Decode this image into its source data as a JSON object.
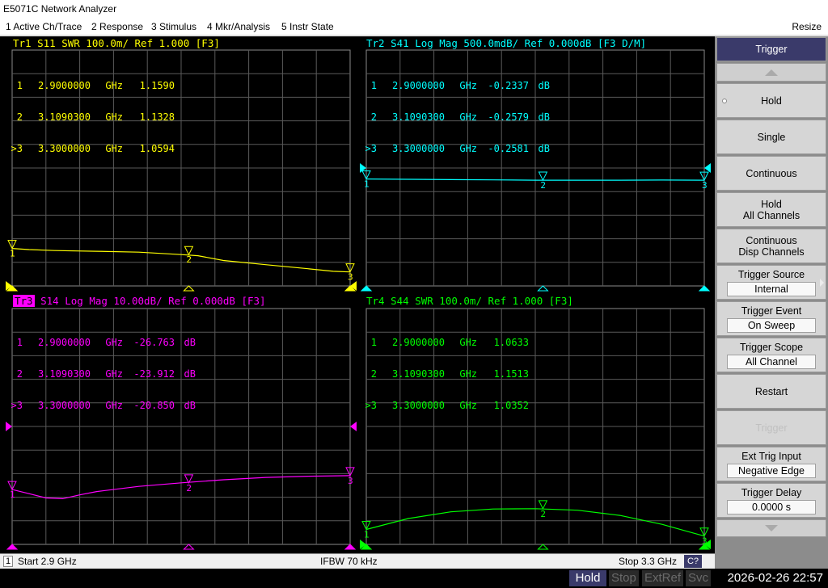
{
  "window": {
    "title": "E5071C Network Analyzer"
  },
  "menu": {
    "items": [
      "1 Active Ch/Trace",
      "2 Response",
      "3 Stimulus",
      "4 Mkr/Analysis",
      "5 Instr State"
    ],
    "resize": "Resize"
  },
  "traces": [
    {
      "id": "tr1",
      "color": "#ffff00",
      "header": "Tr1 S11 SWR 100.0m/ Ref 1.000 [F3]",
      "markers": [
        {
          "idx": "1",
          "freq": "2.9000000",
          "unit": "GHz",
          "value": "1.1590",
          "vunit": ""
        },
        {
          "idx": "2",
          "freq": "3.1090300",
          "unit": "GHz",
          "value": "1.1328",
          "vunit": ""
        },
        {
          "idx": ">3",
          "freq": "3.3000000",
          "unit": "GHz",
          "value": "1.0594",
          "vunit": ""
        }
      ],
      "scale": {
        "ref": 1.0,
        "per_div": 0.1,
        "ref_div": 0
      },
      "points": [
        [
          2.9,
          1.159
        ],
        [
          2.92,
          1.154
        ],
        [
          2.95,
          1.15
        ],
        [
          3.0,
          1.147
        ],
        [
          3.05,
          1.143
        ],
        [
          3.1,
          1.1328
        ],
        [
          3.12,
          1.128
        ],
        [
          3.15,
          1.108
        ],
        [
          3.2,
          1.09
        ],
        [
          3.25,
          1.073
        ],
        [
          3.28,
          1.062
        ],
        [
          3.3,
          1.0594
        ]
      ],
      "marker_labels": [
        "1",
        "2",
        "3"
      ]
    },
    {
      "id": "tr2",
      "color": "#00ffff",
      "header": "Tr2 S41 Log Mag 500.0mdB/ Ref 0.000dB [F3 D/M]",
      "markers": [
        {
          "idx": "1",
          "freq": "2.9000000",
          "unit": "GHz",
          "value": "-0.2337",
          "vunit": "dB"
        },
        {
          "idx": "2",
          "freq": "3.1090300",
          "unit": "GHz",
          "value": "-0.2579",
          "vunit": "dB"
        },
        {
          "idx": ">3",
          "freq": "3.3000000",
          "unit": "GHz",
          "value": "-0.2581",
          "vunit": "dB"
        }
      ],
      "scale": {
        "ref": 0.0,
        "per_div": 0.5,
        "ref_div": 5
      },
      "points": [
        [
          2.9,
          -0.2337
        ],
        [
          2.95,
          -0.24
        ],
        [
          3.0,
          -0.247
        ],
        [
          3.05,
          -0.252
        ],
        [
          3.1,
          -0.2579
        ],
        [
          3.15,
          -0.258
        ],
        [
          3.2,
          -0.258
        ],
        [
          3.25,
          -0.255
        ],
        [
          3.3,
          -0.2581
        ]
      ],
      "marker_labels": [
        "1",
        "2",
        "3",
        "2"
      ]
    },
    {
      "id": "tr3",
      "color": "#ff00ff",
      "header": "S14 Log Mag 10.00dB/ Ref 0.000dB [F3]",
      "header_box": "Tr3",
      "markers": [
        {
          "idx": "1",
          "freq": "2.9000000",
          "unit": "GHz",
          "value": "-26.763",
          "vunit": "dB"
        },
        {
          "idx": "2",
          "freq": "3.1090300",
          "unit": "GHz",
          "value": "-23.912",
          "vunit": "dB"
        },
        {
          "idx": ">3",
          "freq": "3.3000000",
          "unit": "GHz",
          "value": "-20.850",
          "vunit": "dB"
        }
      ],
      "scale": {
        "ref": 0.0,
        "per_div": 10.0,
        "ref_div": 5
      },
      "points": [
        [
          2.9,
          -26.763
        ],
        [
          2.92,
          -28.5
        ],
        [
          2.94,
          -30.3
        ],
        [
          2.96,
          -30.6
        ],
        [
          2.98,
          -29.0
        ],
        [
          3.0,
          -27.6
        ],
        [
          3.05,
          -25.4
        ],
        [
          3.1,
          -23.912
        ],
        [
          3.15,
          -22.6
        ],
        [
          3.2,
          -21.6
        ],
        [
          3.25,
          -21.1
        ],
        [
          3.3,
          -20.85
        ]
      ],
      "marker_labels": [
        "1",
        "2",
        "3"
      ]
    },
    {
      "id": "tr4",
      "color": "#00ff00",
      "header": "Tr4 S44 SWR 100.0m/ Ref 1.000 [F3]",
      "markers": [
        {
          "idx": "1",
          "freq": "2.9000000",
          "unit": "GHz",
          "value": "1.0633",
          "vunit": ""
        },
        {
          "idx": "2",
          "freq": "3.1090300",
          "unit": "GHz",
          "value": "1.1513",
          "vunit": ""
        },
        {
          "idx": ">3",
          "freq": "3.3000000",
          "unit": "GHz",
          "value": "1.0352",
          "vunit": ""
        }
      ],
      "scale": {
        "ref": 1.0,
        "per_div": 0.1,
        "ref_div": 0
      },
      "points": [
        [
          2.9,
          1.0633
        ],
        [
          2.95,
          1.11
        ],
        [
          3.0,
          1.138
        ],
        [
          3.05,
          1.15
        ],
        [
          3.1,
          1.1513
        ],
        [
          3.15,
          1.145
        ],
        [
          3.2,
          1.123
        ],
        [
          3.25,
          1.085
        ],
        [
          3.28,
          1.055
        ],
        [
          3.3,
          1.0352
        ]
      ],
      "marker_labels": [
        "1",
        "2",
        "3",
        "4"
      ]
    }
  ],
  "stimulus": {
    "start_hz": 2.9,
    "stop_hz": 3.3
  },
  "status": {
    "channel": "1",
    "start": "Start 2.9 GHz",
    "ifbw": "IFBW 70 kHz",
    "stop": "Stop 3.3 GHz",
    "cal": "C?"
  },
  "bottom": {
    "hold": "Hold",
    "stop": "Stop",
    "extref": "ExtRef",
    "svc": "Svc",
    "datetime": "2026-02-26 22:57"
  },
  "softkeys": {
    "title": "Trigger",
    "hold": "Hold",
    "single": "Single",
    "continuous": "Continuous",
    "hold_all_1": "Hold",
    "hold_all_2": "All Channels",
    "cont_disp_1": "Continuous",
    "cont_disp_2": "Disp Channels",
    "trigger_source": "Trigger Source",
    "trigger_source_value": "Internal",
    "trigger_event": "Trigger Event",
    "trigger_event_value": "On Sweep",
    "trigger_scope": "Trigger Scope",
    "trigger_scope_value": "All Channel",
    "restart": "Restart",
    "trigger": "Trigger",
    "ext_trig_input": "Ext Trig Input",
    "ext_trig_input_value": "Negative Edge",
    "trigger_delay": "Trigger Delay",
    "trigger_delay_value": "0.0000 s"
  }
}
